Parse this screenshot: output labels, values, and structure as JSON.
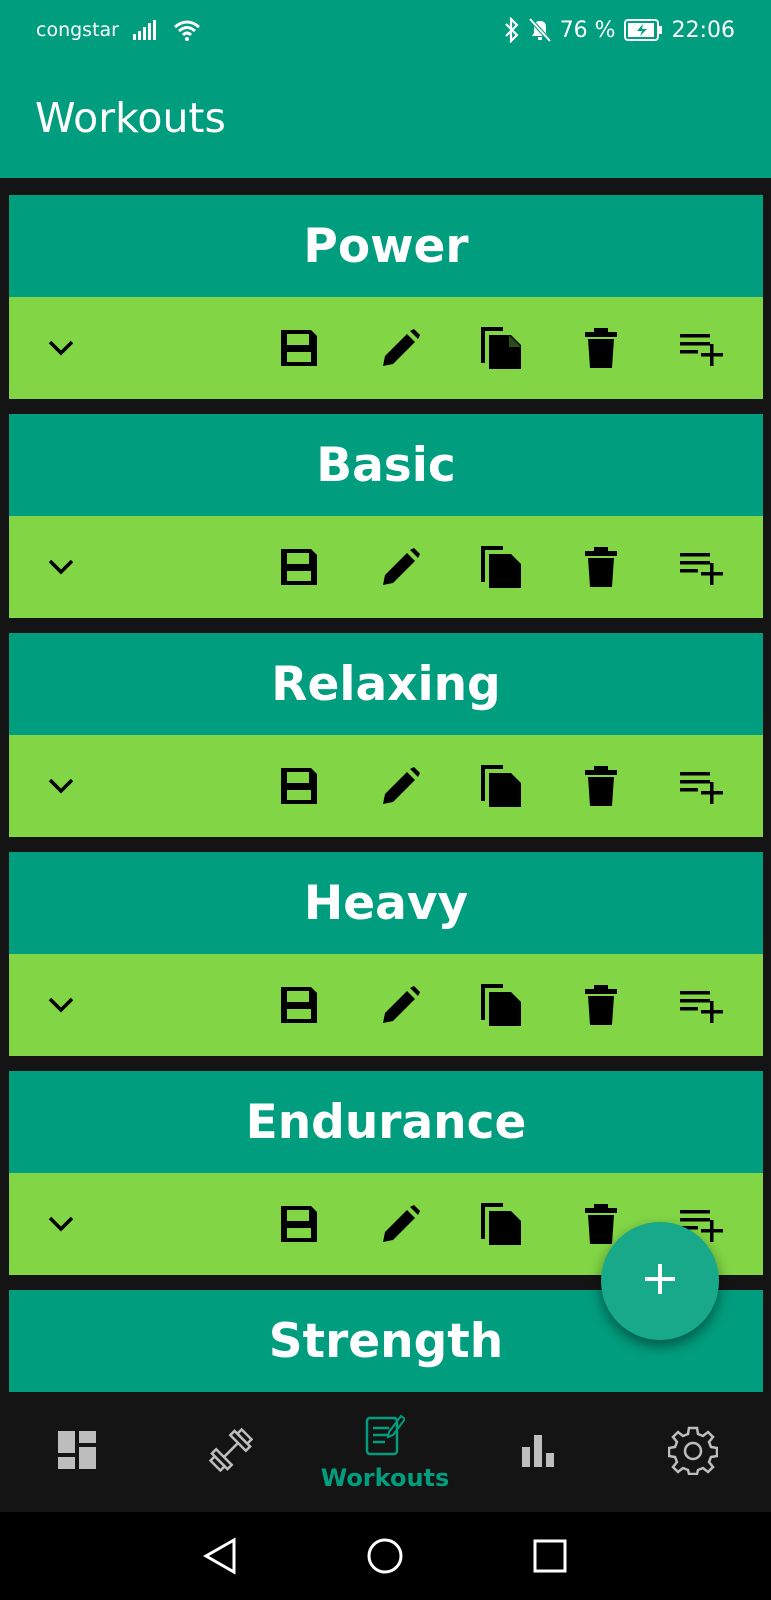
{
  "status_bar": {
    "carrier": "congstar",
    "battery_percent": "76 %",
    "time": "22:06"
  },
  "header": {
    "title": "Workouts"
  },
  "workouts": [
    {
      "name": "Power"
    },
    {
      "name": "Basic"
    },
    {
      "name": "Relaxing"
    },
    {
      "name": "Heavy"
    },
    {
      "name": "Endurance"
    },
    {
      "name": "Strength"
    }
  ],
  "card_actions": [
    "chevron-down-icon",
    "save-icon",
    "edit-icon",
    "copy-icon",
    "delete-icon",
    "playlist-add-icon"
  ],
  "bottom_nav": {
    "items": [
      {
        "icon": "dashboard-icon",
        "label": ""
      },
      {
        "icon": "dumbbell-icon",
        "label": ""
      },
      {
        "icon": "workouts-icon",
        "label": "Workouts"
      },
      {
        "icon": "bar-chart-icon",
        "label": ""
      },
      {
        "icon": "gear-icon",
        "label": ""
      }
    ],
    "active": "Workouts"
  },
  "colors": {
    "primary": "#009e7e",
    "action_bar": "#82d646",
    "background": "#141414",
    "fab": "#17a98a"
  }
}
